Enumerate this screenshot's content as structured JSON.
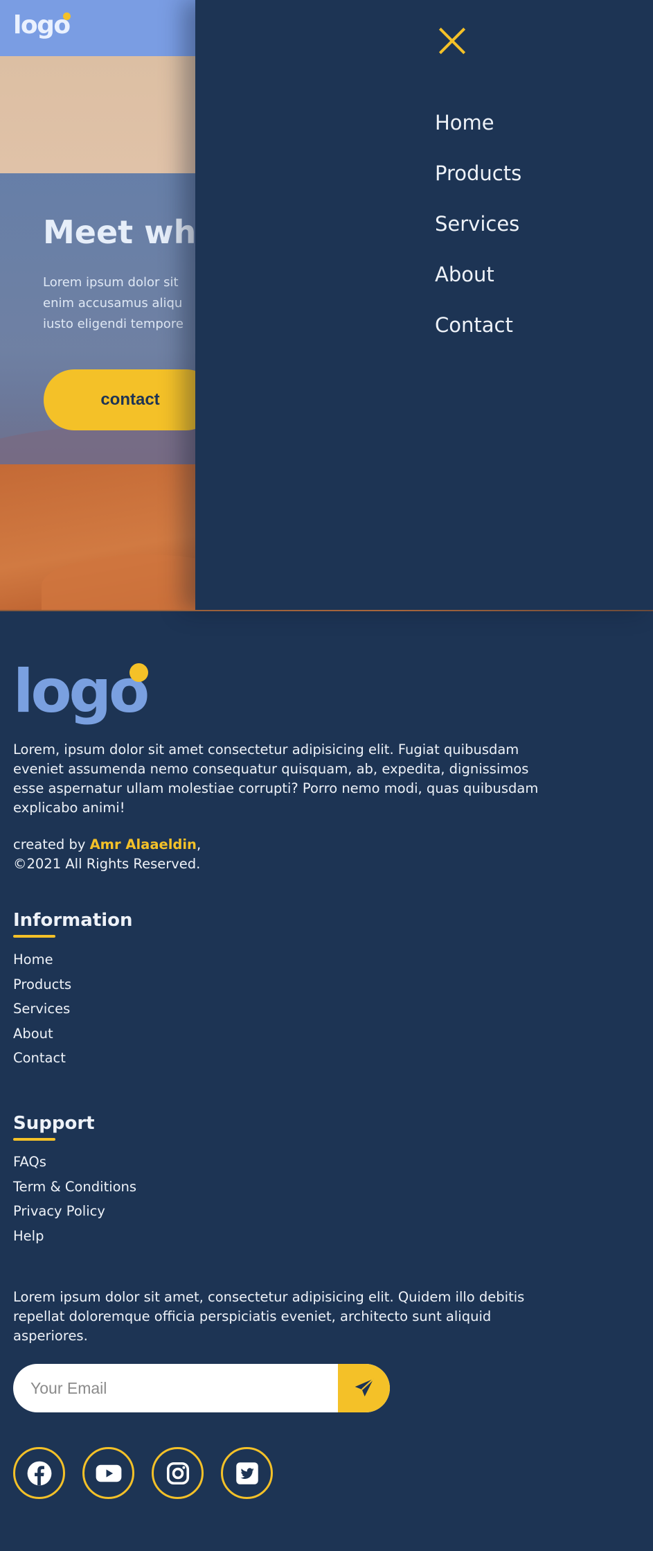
{
  "header": {
    "logo_text": "logo"
  },
  "hero": {
    "title": "Meet wha",
    "text": "Lorem ipsum dolor sit enim accusamus aliqu iusto eligendi tempore",
    "text_lines": [
      "Lorem ipsum dolor sit",
      "enim accusamus aliqu",
      "iusto eligendi tempore"
    ],
    "cta_label": "contact"
  },
  "side_menu": {
    "close_icon": "close-icon",
    "items": [
      {
        "label": "Home"
      },
      {
        "label": "Products"
      },
      {
        "label": "Services"
      },
      {
        "label": "About"
      },
      {
        "label": "Contact"
      }
    ]
  },
  "footer": {
    "logo_text": "logo",
    "about": "Lorem, ipsum dolor sit amet consectetur adipisicing elit. Fugiat quibusdam eveniet assumenda nemo consequatur quisquam, ab, expedita, dignissimos esse aspernatur ullam molestiae corrupti? Porro nemo modi, quas quibusdam explicabo animi!",
    "created_prefix": "created by ",
    "author": "Amr Alaaeldin",
    "created_suffix": ",",
    "copyright": "©2021 All Rights Reserved.",
    "information": {
      "title": "Information",
      "links": [
        {
          "label": "Home"
        },
        {
          "label": "Products"
        },
        {
          "label": "Services"
        },
        {
          "label": "About"
        },
        {
          "label": "Contact"
        }
      ]
    },
    "support": {
      "title": "Support",
      "links": [
        {
          "label": "FAQs"
        },
        {
          "label": "Term & Conditions"
        },
        {
          "label": "Privacy Policy"
        },
        {
          "label": "Help"
        }
      ]
    },
    "newsletter": {
      "text": "Lorem ipsum dolor sit amet, consectetur adipisicing elit. Quidem illo debitis repellat doloremque officia perspiciatis eveniet, architecto sunt aliquid asperiores.",
      "email_placeholder": "Your Email",
      "send_icon": "paper-plane-icon"
    },
    "socials": [
      {
        "icon": "facebook-icon"
      },
      {
        "icon": "youtube-icon"
      },
      {
        "icon": "instagram-icon"
      },
      {
        "icon": "twitter-icon"
      }
    ]
  },
  "colors": {
    "navy": "#1d3454",
    "accent_yellow": "#f4c128",
    "logo_blue": "#7aa0e0",
    "header_blue": "#7a9de3"
  }
}
